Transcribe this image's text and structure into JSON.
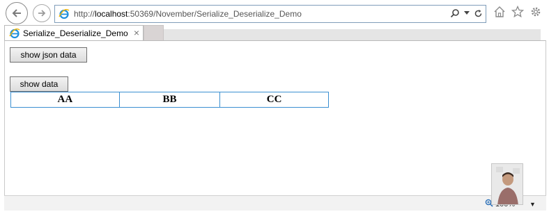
{
  "browser": {
    "url_prefix": "http://",
    "url_host": "localhost",
    "url_rest": ":50369/November/Serialize_Deserialize_Demo",
    "tab_title": "Serialize_Deserialize_Demo",
    "tab_close": "×",
    "zoom_level": "100%"
  },
  "page": {
    "show_json_label": "show json data",
    "show_data_label": "show data",
    "table_cells": [
      "AA",
      "BB",
      "CC"
    ]
  },
  "colors": {
    "table_border": "#3a8fd1",
    "address_border": "#7f9db9",
    "ie_logo": "#1e8fdc"
  },
  "icons": [
    "back-arrow-icon",
    "forward-arrow-icon",
    "ie-logo-icon",
    "search-icon",
    "dropdown-caret-icon",
    "refresh-icon",
    "home-icon",
    "favorites-star-icon",
    "settings-gear-icon",
    "zoom-icon",
    "close-icon"
  ]
}
